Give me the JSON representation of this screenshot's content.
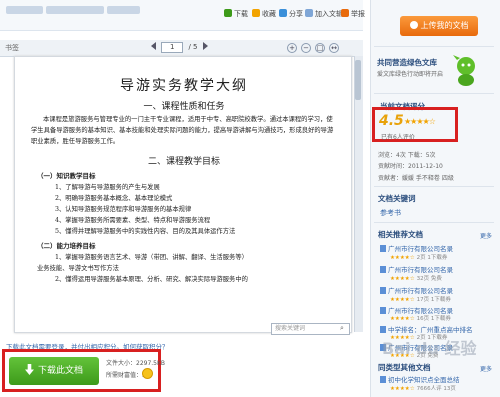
{
  "toolbar": {
    "download": "下载",
    "favorite": "收藏",
    "share": "分享",
    "add_to_library": "加入文辑",
    "report": "举报"
  },
  "viewer": {
    "label": "书签",
    "current_page": "1",
    "total_pages": "/ 5",
    "search_placeholder": "搜索关键词"
  },
  "document": {
    "title": "导游实务教学大纲",
    "section1": "一、课程性质和任务",
    "section1_text": "本课程是旅游服务与管理专业的一门主干专业课程，适用于中专、高职院校教学。通过本课程的学习，使学生具备导游服务的基本知识、基本技能和处理实际问题的能力，提高导游讲解与沟通技巧，形成良好的导游职业素质，胜任导游服务工作。",
    "section2": "二、课程教学目标",
    "sub1": "（一）知识教学目标",
    "items1": [
      "1、了解导游与导游服务的产生与发展",
      "2、明确导游服务基本概念、基本理论模式",
      "3、认知导游服务规范程序和导游服务的基本规律",
      "4、掌握导游服务所需要素、类型、特点和导游服务流程",
      "5、懂得并理解导游服务中的实践性内容、目的及其具体运作方法"
    ],
    "sub2": "（二）能力培养目标",
    "items2": [
      "1、掌握导游服务语言艺术、导游（带团、讲解、翻译、生活服务等）",
      "业务技能、导游文书写作方法",
      "2、懂得运用导游服务基本原理、分析、研究、解决实际导游服务中的"
    ]
  },
  "notice": "下载此文档需要登录，并付出相应积分。如何获取积分？",
  "download_box": {
    "button": "下载此文档",
    "size": "文件大小：2297.5KB",
    "cost": "所需财富值：5"
  },
  "sidebar": {
    "upload": "上传我的文档",
    "build_title": "共同营造绿色文库",
    "build_sub": "爱文库绿色行动即将开启",
    "rating_title": "当前文档评分",
    "rating_score": "4.5",
    "rating_stars": "★★★★☆",
    "rating_count": "已有6人评价",
    "meta": [
      "浏览：4次   下载：5次",
      "贡献时间：2011-12-10",
      "贡献者：媛媛   手不释卷 四级"
    ],
    "keywords_title": "文档关键词",
    "keyword": "参考书",
    "related_title": "相关推荐文档",
    "more": "更多",
    "related": [
      {
        "title": "广州市行有限公司名录",
        "stars": "★★★★☆",
        "info": "2页 1下载券"
      },
      {
        "title": "广州市行有限公司名录",
        "stars": "★★★★☆",
        "info": "32页 免费"
      },
      {
        "title": "广州市行有限公司名录",
        "stars": "★★★★☆",
        "info": "17页 1下载券"
      },
      {
        "title": "广州市行有限公司名录",
        "stars": "★★★★☆",
        "info": "16页 1下载券"
      },
      {
        "title": "中学排名：广州重点高中排名",
        "stars": "★★★★☆",
        "info": "2页 1下载券"
      },
      {
        "title": "广州市行有限公司名录",
        "stars": "★★★★☆",
        "info": "2页 免费"
      }
    ],
    "other_title": "同类型其他文档",
    "other_item": "初中化学知识点全面总结",
    "other_stars": "★★★★☆",
    "other_info": "7666人评 13页"
  },
  "watermark": "Bai du 经验"
}
